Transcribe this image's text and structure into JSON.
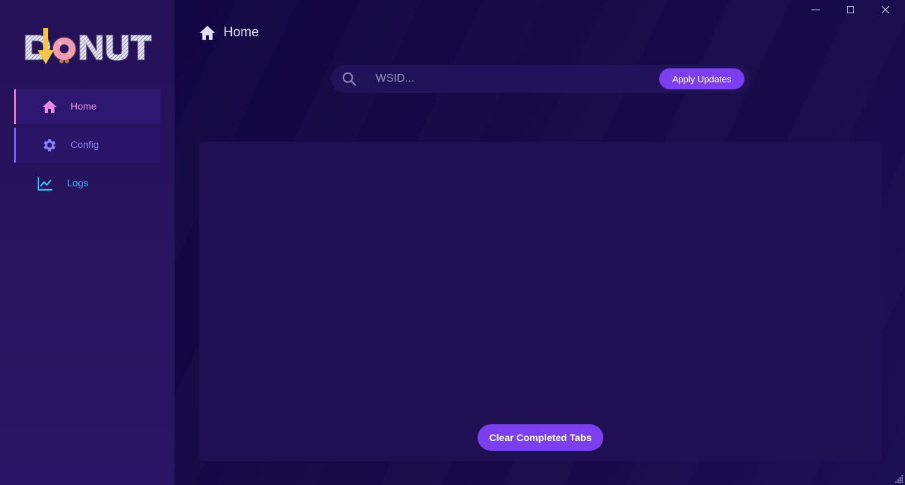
{
  "app": {
    "logo_text": "DONUT",
    "accent_color": "#7b3ff0"
  },
  "sidebar": {
    "items": [
      {
        "label": "Home",
        "icon": "home-icon",
        "color": "#e68ce0"
      },
      {
        "label": "Config",
        "icon": "gear-icon",
        "color": "#8c80ff"
      },
      {
        "label": "Logs",
        "icon": "chart-line-icon",
        "color": "#33c6f0"
      }
    ]
  },
  "header": {
    "title": "Home",
    "icon": "home-icon"
  },
  "window_controls": {
    "minimize": "minimize-icon",
    "maximize": "maximize-icon",
    "close": "close-icon"
  },
  "search": {
    "placeholder": "WSID...",
    "value": "",
    "icon": "search-icon",
    "apply_label": "Apply Updates"
  },
  "panel": {
    "clear_label": "Clear Completed Tabs"
  }
}
